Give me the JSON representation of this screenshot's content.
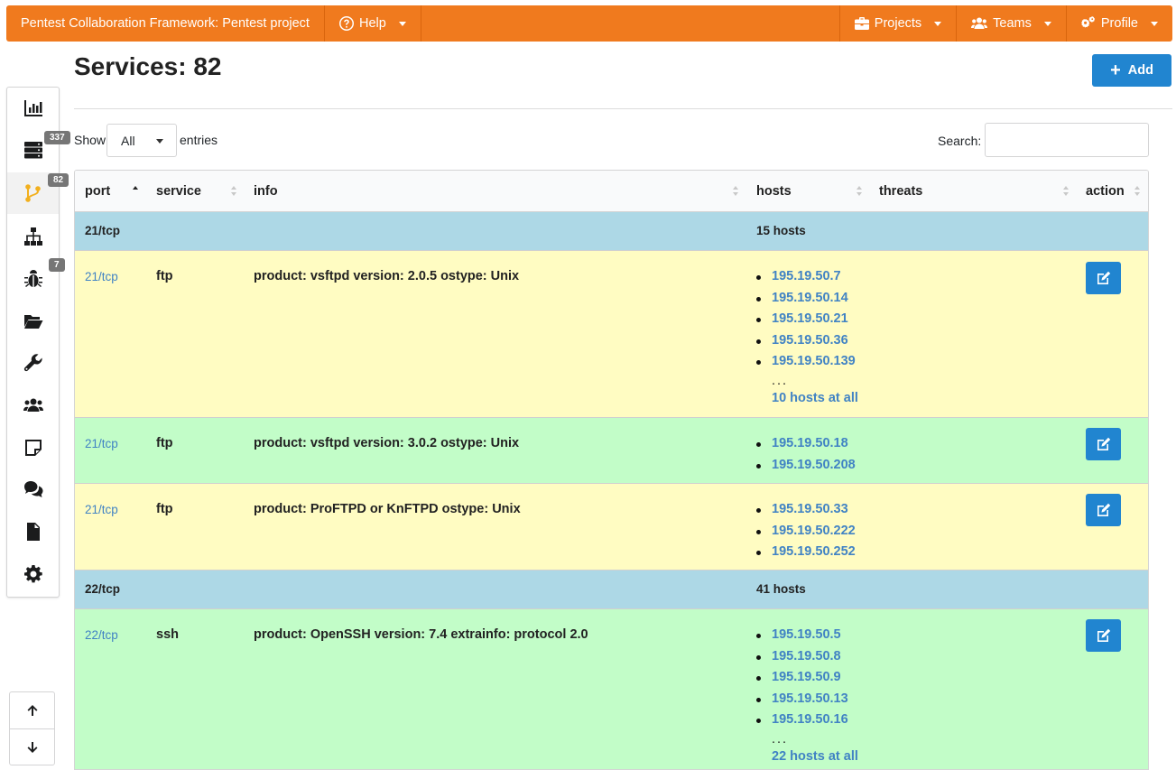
{
  "navbar": {
    "brand": "Pentest Collaboration Framework: Pentest project",
    "help": "Help",
    "projects": "Projects",
    "teams": "Teams",
    "profile": "Profile"
  },
  "page": {
    "title": "Services: 82",
    "add_label": "Add"
  },
  "sidebar": {
    "badges": {
      "hosts": "337",
      "services": "82",
      "issues": "7"
    },
    "icons": [
      "chart-bar-icon",
      "server-icon",
      "code-branch-icon",
      "sitemap-icon",
      "bug-icon",
      "folder-open-icon",
      "wrench-icon",
      "users-icon",
      "sticky-note-icon",
      "comments-icon",
      "file-pdf-icon",
      "cog-icon"
    ]
  },
  "controls": {
    "show_label": "Show",
    "entries_selected": "All",
    "entries_label": "entries",
    "search_label": "Search:",
    "search_value": ""
  },
  "table": {
    "columns": [
      "port",
      "service",
      "info",
      "hosts",
      "threats",
      "action"
    ],
    "groups": [
      {
        "port": "21/tcp",
        "hosts_count": "15 hosts"
      },
      {
        "port": "22/tcp",
        "hosts_count": "41 hosts"
      }
    ],
    "rows": [
      {
        "port": "21/tcp",
        "service": "ftp",
        "info": "product: vsftpd version: 2.0.5 ostype: Unix",
        "hosts": [
          "195.19.50.7",
          "195.19.50.14",
          "195.19.50.21",
          "195.19.50.36",
          "195.19.50.139"
        ],
        "ellipsis": "...",
        "more": "10 hosts at all",
        "color": "#fffcc2"
      },
      {
        "port": "21/tcp",
        "service": "ftp",
        "info": "product: vsftpd version: 3.0.2 ostype: Unix",
        "hosts": [
          "195.19.50.18",
          "195.19.50.208"
        ],
        "color": "#c2fdc8"
      },
      {
        "port": "21/tcp",
        "service": "ftp",
        "info": "product: ProFTPD or KnFTPD ostype: Unix",
        "hosts": [
          "195.19.50.33",
          "195.19.50.222",
          "195.19.50.252"
        ],
        "color": "#fffcc2"
      },
      {
        "port": "22/tcp",
        "service": "ssh",
        "info": "product: OpenSSH version: 7.4 extrainfo: protocol 2.0",
        "hosts": [
          "195.19.50.5",
          "195.19.50.8",
          "195.19.50.9",
          "195.19.50.13",
          "195.19.50.16"
        ],
        "ellipsis": "...",
        "more": "22 hosts at all",
        "color": "#c2fdc8"
      }
    ]
  }
}
